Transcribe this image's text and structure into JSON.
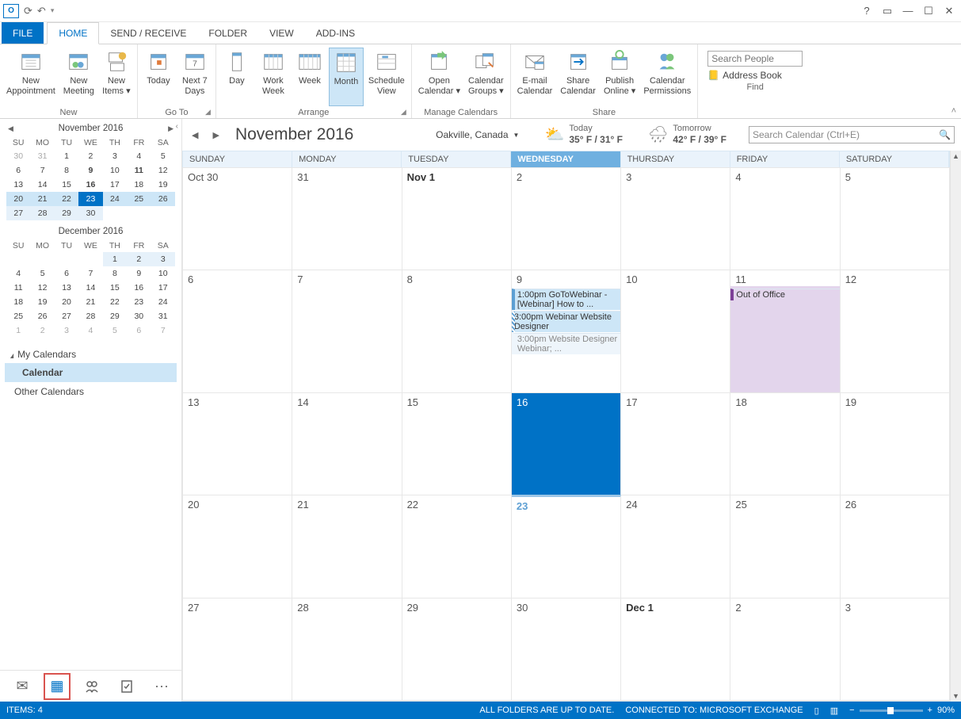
{
  "titlebar": {
    "help": "?",
    "ribbonopts": "▭",
    "min": "—",
    "max": "☐",
    "close": "✕"
  },
  "tabs": {
    "file": "FILE",
    "home": "HOME",
    "sendreceive": "SEND / RECEIVE",
    "folder": "FOLDER",
    "view": "VIEW",
    "addins": "ADD-INS"
  },
  "ribbon": {
    "new_appointment": "New\nAppointment",
    "new_meeting": "New\nMeeting",
    "new_items": "New\nItems ▾",
    "group_new": "New",
    "today": "Today",
    "next7": "Next 7\nDays",
    "group_goto": "Go To",
    "day": "Day",
    "workweek": "Work\nWeek",
    "week": "Week",
    "month": "Month",
    "schedule": "Schedule\nView",
    "group_arrange": "Arrange",
    "open_cal": "Open\nCalendar ▾",
    "cal_groups": "Calendar\nGroups ▾",
    "group_manage": "Manage Calendars",
    "email_cal": "E-mail\nCalendar",
    "share_cal": "Share\nCalendar",
    "publish": "Publish\nOnline ▾",
    "permissions": "Calendar\nPermissions",
    "group_share": "Share",
    "search_people": "Search People",
    "address_book": "Address Book",
    "group_find": "Find"
  },
  "mini1": {
    "title": "November 2016",
    "dow": [
      "SU",
      "MO",
      "TU",
      "WE",
      "TH",
      "FR",
      "SA"
    ],
    "rows": [
      [
        {
          "n": "30",
          "d": 1
        },
        {
          "n": "31",
          "d": 1
        },
        {
          "n": "1"
        },
        {
          "n": "2"
        },
        {
          "n": "3"
        },
        {
          "n": "4"
        },
        {
          "n": "5"
        }
      ],
      [
        {
          "n": "6"
        },
        {
          "n": "7"
        },
        {
          "n": "8"
        },
        {
          "n": "9",
          "b": 1
        },
        {
          "n": "10"
        },
        {
          "n": "11",
          "b": 1
        },
        {
          "n": "12"
        }
      ],
      [
        {
          "n": "13"
        },
        {
          "n": "14"
        },
        {
          "n": "15"
        },
        {
          "n": "16",
          "b": 1
        },
        {
          "n": "17"
        },
        {
          "n": "18"
        },
        {
          "n": "19"
        }
      ],
      [
        {
          "n": "20",
          "r": 1
        },
        {
          "n": "21",
          "r": 1
        },
        {
          "n": "22",
          "r": 1
        },
        {
          "n": "23",
          "t": 1
        },
        {
          "n": "24",
          "r": 1
        },
        {
          "n": "25",
          "r": 1
        },
        {
          "n": "26",
          "r": 1
        }
      ],
      [
        {
          "n": "27",
          "rl": 1
        },
        {
          "n": "28",
          "rl": 1
        },
        {
          "n": "29",
          "rl": 1
        },
        {
          "n": "30",
          "rl": 1
        },
        {
          "n": ""
        },
        {
          "n": ""
        },
        {
          "n": ""
        }
      ]
    ]
  },
  "mini2": {
    "title": "December 2016",
    "dow": [
      "SU",
      "MO",
      "TU",
      "WE",
      "TH",
      "FR",
      "SA"
    ],
    "rows": [
      [
        {
          "n": ""
        },
        {
          "n": ""
        },
        {
          "n": ""
        },
        {
          "n": ""
        },
        {
          "n": "1",
          "rl": 1
        },
        {
          "n": "2",
          "rl": 1
        },
        {
          "n": "3",
          "rl": 1
        }
      ],
      [
        {
          "n": "4"
        },
        {
          "n": "5"
        },
        {
          "n": "6"
        },
        {
          "n": "7"
        },
        {
          "n": "8"
        },
        {
          "n": "9"
        },
        {
          "n": "10"
        }
      ],
      [
        {
          "n": "11"
        },
        {
          "n": "12"
        },
        {
          "n": "13"
        },
        {
          "n": "14"
        },
        {
          "n": "15"
        },
        {
          "n": "16"
        },
        {
          "n": "17"
        }
      ],
      [
        {
          "n": "18"
        },
        {
          "n": "19"
        },
        {
          "n": "20"
        },
        {
          "n": "21"
        },
        {
          "n": "22"
        },
        {
          "n": "23"
        },
        {
          "n": "24"
        }
      ],
      [
        {
          "n": "25"
        },
        {
          "n": "26"
        },
        {
          "n": "27"
        },
        {
          "n": "28"
        },
        {
          "n": "29"
        },
        {
          "n": "30"
        },
        {
          "n": "31"
        }
      ],
      [
        {
          "n": "1",
          "d": 1
        },
        {
          "n": "2",
          "d": 1
        },
        {
          "n": "3",
          "d": 1
        },
        {
          "n": "4",
          "d": 1
        },
        {
          "n": "5",
          "d": 1
        },
        {
          "n": "6",
          "d": 1
        },
        {
          "n": "7",
          "d": 1
        }
      ]
    ]
  },
  "tree": {
    "my": "My Calendars",
    "calendar": "Calendar",
    "other": "Other Calendars"
  },
  "calhdr": {
    "title": "November 2016",
    "location": "Oakville, Canada",
    "w1_label": "Today",
    "w1_temp": "35° F / 31° F",
    "w2_label": "Tomorrow",
    "w2_temp": "42° F / 39° F",
    "search_ph": "Search Calendar (Ctrl+E)"
  },
  "dow": [
    "SUNDAY",
    "MONDAY",
    "TUESDAY",
    "WEDNESDAY",
    "THURSDAY",
    "FRIDAY",
    "SATURDAY"
  ],
  "weeks": [
    [
      {
        "n": "Oct 30"
      },
      {
        "n": "31"
      },
      {
        "n": "Nov 1",
        "b": 1
      },
      {
        "n": "2"
      },
      {
        "n": "3"
      },
      {
        "n": "4"
      },
      {
        "n": "5"
      }
    ],
    [
      {
        "n": "6"
      },
      {
        "n": "7"
      },
      {
        "n": "8"
      },
      {
        "n": "9",
        "events": [
          {
            "t": "1:00pm GoToWebinar - [Webinar] How to ...",
            "c": "blue"
          },
          {
            "t": "3:00pm Webinar Website Designer",
            "c": "blue2"
          },
          {
            "t": "3:00pm Website Designer Webinar; ...",
            "c": "faded"
          }
        ]
      },
      {
        "n": "10"
      },
      {
        "n": "11",
        "ooo": 1,
        "events": [
          {
            "t": "Out of Office",
            "c": "purple"
          }
        ]
      },
      {
        "n": "12"
      }
    ],
    [
      {
        "n": "13"
      },
      {
        "n": "14"
      },
      {
        "n": "15"
      },
      {
        "n": "16",
        "sel": 1
      },
      {
        "n": "17"
      },
      {
        "n": "18"
      },
      {
        "n": "19"
      }
    ],
    [
      {
        "n": "20"
      },
      {
        "n": "21"
      },
      {
        "n": "22"
      },
      {
        "n": "23",
        "today": 1
      },
      {
        "n": "24"
      },
      {
        "n": "25"
      },
      {
        "n": "26"
      }
    ],
    [
      {
        "n": "27"
      },
      {
        "n": "28"
      },
      {
        "n": "29"
      },
      {
        "n": "30"
      },
      {
        "n": "Dec 1",
        "b": 1
      },
      {
        "n": "2"
      },
      {
        "n": "3"
      }
    ],
    [
      {
        "n": ""
      },
      {
        "n": ""
      },
      {
        "n": ""
      },
      {
        "n": ""
      },
      {
        "n": ""
      },
      {
        "n": ""
      },
      {
        "n": ""
      }
    ]
  ],
  "status": {
    "items": "ITEMS: 4",
    "sync": "ALL FOLDERS ARE UP TO DATE.",
    "conn": "CONNECTED TO: MICROSOFT EXCHANGE",
    "zoom": "90%"
  }
}
